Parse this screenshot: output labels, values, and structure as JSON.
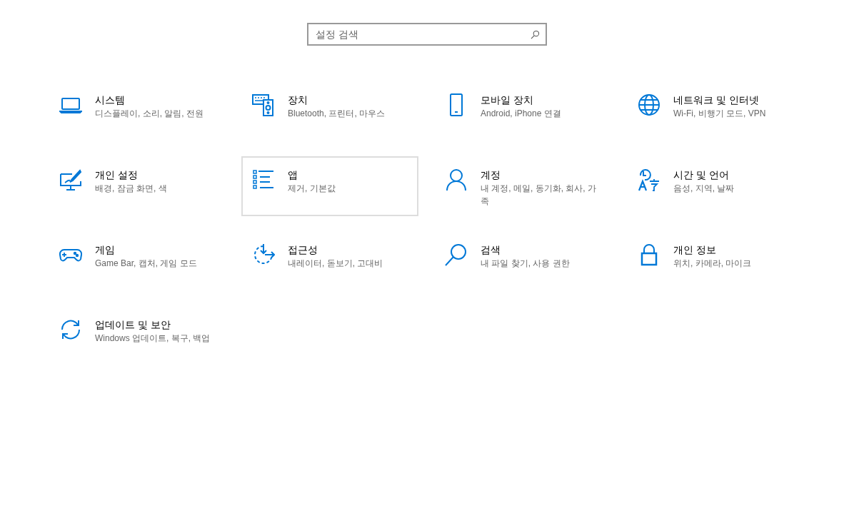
{
  "search": {
    "placeholder": "설정 검색"
  },
  "categories": [
    {
      "title": "시스템",
      "subtitle": "디스플레이, 소리, 알림, 전원",
      "selected": false
    },
    {
      "title": "장치",
      "subtitle": "Bluetooth, 프린터, 마우스",
      "selected": false
    },
    {
      "title": "모바일 장치",
      "subtitle": "Android, iPhone 연결",
      "selected": false
    },
    {
      "title": "네트워크 및 인터넷",
      "subtitle": "Wi-Fi, 비행기 모드, VPN",
      "selected": false
    },
    {
      "title": "개인 설정",
      "subtitle": "배경, 잠금 화면, 색",
      "selected": false
    },
    {
      "title": "앱",
      "subtitle": "제거, 기본값",
      "selected": true
    },
    {
      "title": "계정",
      "subtitle": "내 계정, 메일, 동기화, 회사, 가족",
      "selected": false
    },
    {
      "title": "시간 및 언어",
      "subtitle": "음성, 지역, 날짜",
      "selected": false
    },
    {
      "title": "게임",
      "subtitle": "Game Bar, 캡처, 게임 모드",
      "selected": false
    },
    {
      "title": "접근성",
      "subtitle": "내레이터, 돋보기, 고대비",
      "selected": false
    },
    {
      "title": "검색",
      "subtitle": "내 파일 찾기, 사용 권한",
      "selected": false
    },
    {
      "title": "개인 정보",
      "subtitle": "위치, 카메라, 마이크",
      "selected": false
    },
    {
      "title": "업데이트 및 보안",
      "subtitle": "Windows 업데이트, 복구, 백업",
      "selected": false
    }
  ]
}
